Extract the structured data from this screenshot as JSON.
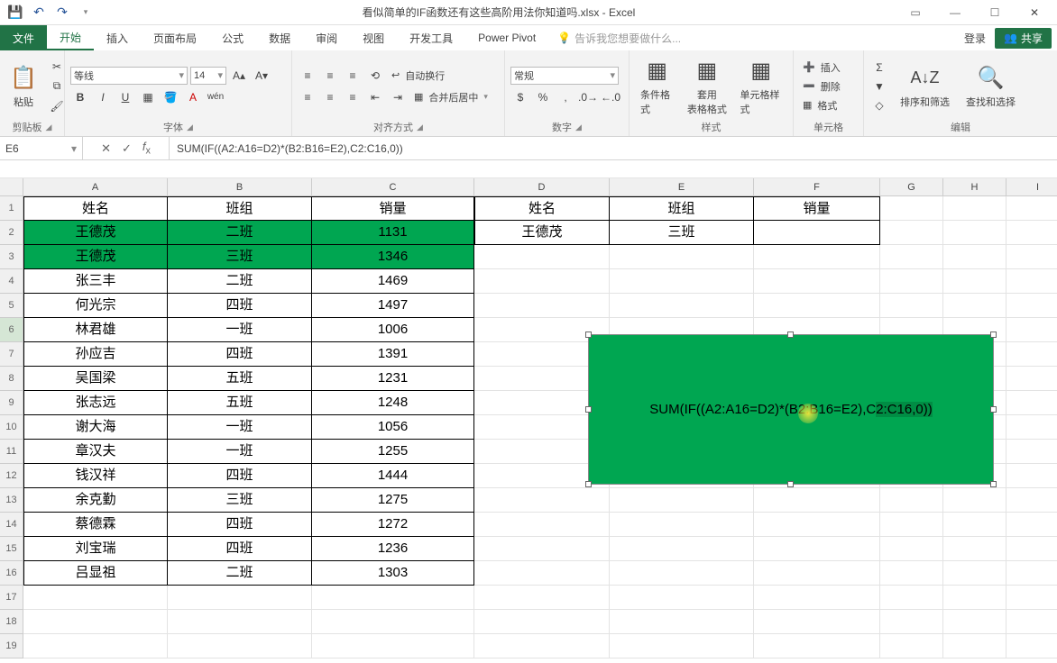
{
  "title": "看似简单的IF函数还有这些高阶用法你知道吗.xlsx - Excel",
  "tabs": {
    "file": "文件",
    "home": "开始",
    "insert": "插入",
    "page_layout": "页面布局",
    "formulas": "公式",
    "data": "数据",
    "review": "审阅",
    "view": "视图",
    "developer": "开发工具",
    "power_pivot": "Power Pivot",
    "tell_me": "告诉我您想要做什么...",
    "login": "登录",
    "share": "共享"
  },
  "ribbon": {
    "clipboard": {
      "paste": "粘贴",
      "label": "剪贴板"
    },
    "font": {
      "name": "等线",
      "size": "14",
      "label": "字体",
      "ruby": "wén"
    },
    "alignment": {
      "wrap": "自动换行",
      "merge": "合并后居中",
      "label": "对齐方式"
    },
    "number": {
      "format": "常规",
      "label": "数字"
    },
    "styles": {
      "cond": "条件格式",
      "table": "套用\n表格格式",
      "cell": "单元格样式",
      "label": "样式"
    },
    "cells": {
      "insert": "插入",
      "delete": "删除",
      "format": "格式",
      "label": "单元格"
    },
    "editing": {
      "sort": "排序和筛选",
      "find": "查找和选择",
      "label": "编辑"
    }
  },
  "namebox": "E6",
  "formula": "SUM(IF((A2:A16=D2)*(B2:B16=E2),C2:C16,0))",
  "chart_data": {
    "type": "table",
    "columns_main": [
      "姓名",
      "班组",
      "销量"
    ],
    "rows_main": [
      [
        "王德茂",
        "二班",
        1131
      ],
      [
        "王德茂",
        "三班",
        1346
      ],
      [
        "张三丰",
        "二班",
        1469
      ],
      [
        "何光宗",
        "四班",
        1497
      ],
      [
        "林君雄",
        "一班",
        1006
      ],
      [
        "孙应吉",
        "四班",
        1391
      ],
      [
        "吴国梁",
        "五班",
        1231
      ],
      [
        "张志远",
        "五班",
        1248
      ],
      [
        "谢大海",
        "一班",
        1056
      ],
      [
        "章汉夫",
        "一班",
        1255
      ],
      [
        "钱汉祥",
        "四班",
        1444
      ],
      [
        "余克勤",
        "三班",
        1275
      ],
      [
        "蔡德霖",
        "四班",
        1272
      ],
      [
        "刘宝瑞",
        "四班",
        1236
      ],
      [
        "吕显祖",
        "二班",
        1303
      ]
    ],
    "columns_lookup": [
      "姓名",
      "班组",
      "销量"
    ],
    "rows_lookup": [
      [
        "王德茂",
        "三班",
        ""
      ]
    ]
  },
  "textbox_formula": "SUM(IF((A2:A16=D2)*(B2:B16=E2),C2:C16,0))",
  "cols": {
    "A": 160,
    "B": 160,
    "C": 180,
    "D": 150,
    "E": 160,
    "F": 140,
    "G": 70,
    "H": 70,
    "I": 70
  }
}
